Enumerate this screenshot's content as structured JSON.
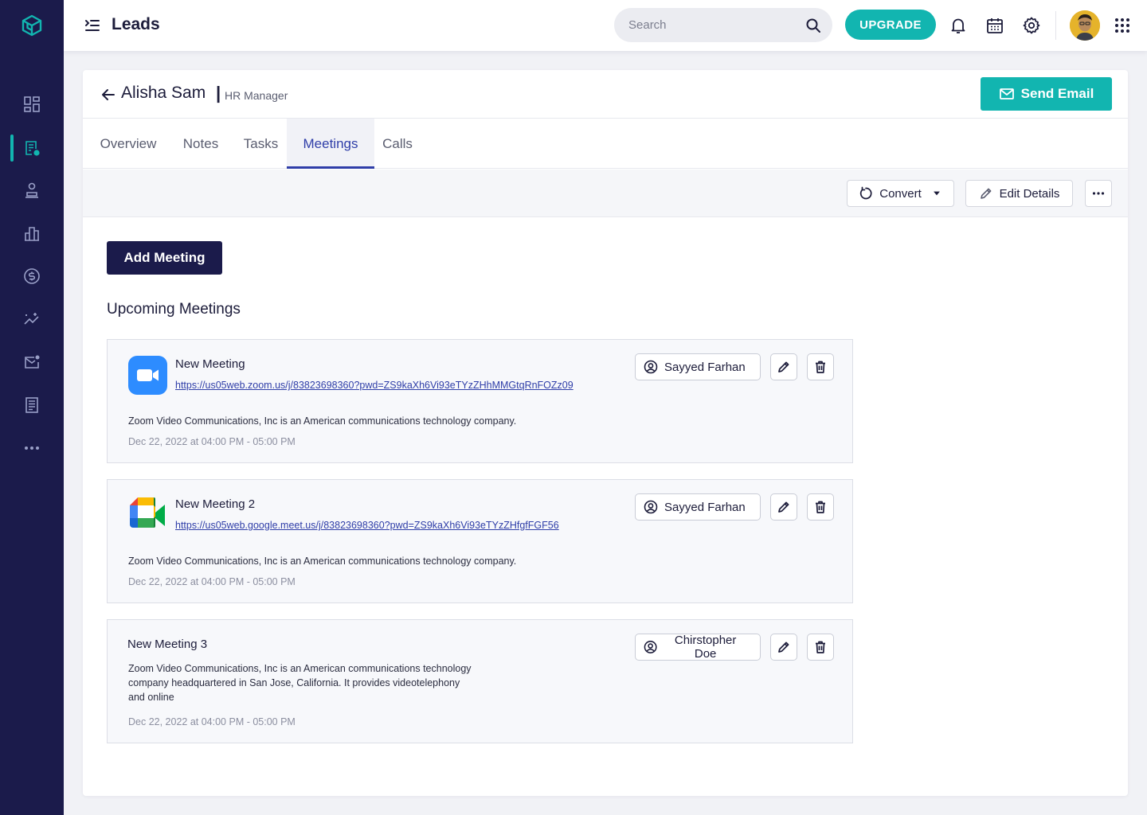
{
  "header": {
    "title": "Leads",
    "search_placeholder": "Search",
    "upgrade_label": "UPGRADE"
  },
  "lead": {
    "name": "Alisha Sam",
    "separator": "|",
    "role": "HR Manager",
    "send_email_label": "Send Email"
  },
  "tabs": [
    {
      "label": "Overview",
      "active": false
    },
    {
      "label": "Notes",
      "active": false
    },
    {
      "label": "Tasks",
      "active": false
    },
    {
      "label": "Meetings",
      "active": true
    },
    {
      "label": "Calls",
      "active": false
    }
  ],
  "toolbar": {
    "convert_label": "Convert",
    "edit_label": "Edit Details"
  },
  "add_meeting_label": "Add Meeting",
  "section_title": "Upcoming Meetings",
  "meetings": [
    {
      "title": "New Meeting",
      "link": "https://us05web.zoom.us/j/83823698360?pwd=ZS9kaXh6Vi93eTYzZHhMMGtqRnFOZz09",
      "description": "Zoom Video Communications, Inc is an American communications technology company.",
      "date": "Dec 22, 2022 at 04:00 PM - 05:00 PM",
      "owner": "Sayyed Farhan",
      "app_icon": "zoom-icon"
    },
    {
      "title": "New Meeting 2",
      "link": "https://us05web.google.meet.us/j/83823698360?pwd=ZS9kaXh6Vi93eTYzZHfgfFGF56",
      "description": "Zoom Video Communications, Inc is an American communications technology company.",
      "date": "Dec 22, 2022 at 04:00 PM - 05:00 PM",
      "owner": "Sayyed Farhan",
      "app_icon": "google-meet-icon"
    },
    {
      "title": "New Meeting 3",
      "description_lines": [
        "Zoom Video Communications, Inc is an American communications technology",
        "company headquartered in San Jose, California. It provides videotelephony",
        "and online"
      ],
      "date": "Dec 22, 2022 at 04:00 PM - 05:00 PM",
      "owner": "Chirstopher Doe"
    }
  ],
  "colors": {
    "sidebar": "#1b1b4b",
    "accent": "#12b5b0",
    "tab_active": "#2f3ea8",
    "primary_dark": "#1b1b4b"
  },
  "sidebar_icons": [
    "dashboard-icon",
    "leads-icon",
    "contacts-icon",
    "reports-icon",
    "deals-icon",
    "analytics-icon",
    "mail-icon",
    "documents-icon",
    "more-icon"
  ]
}
